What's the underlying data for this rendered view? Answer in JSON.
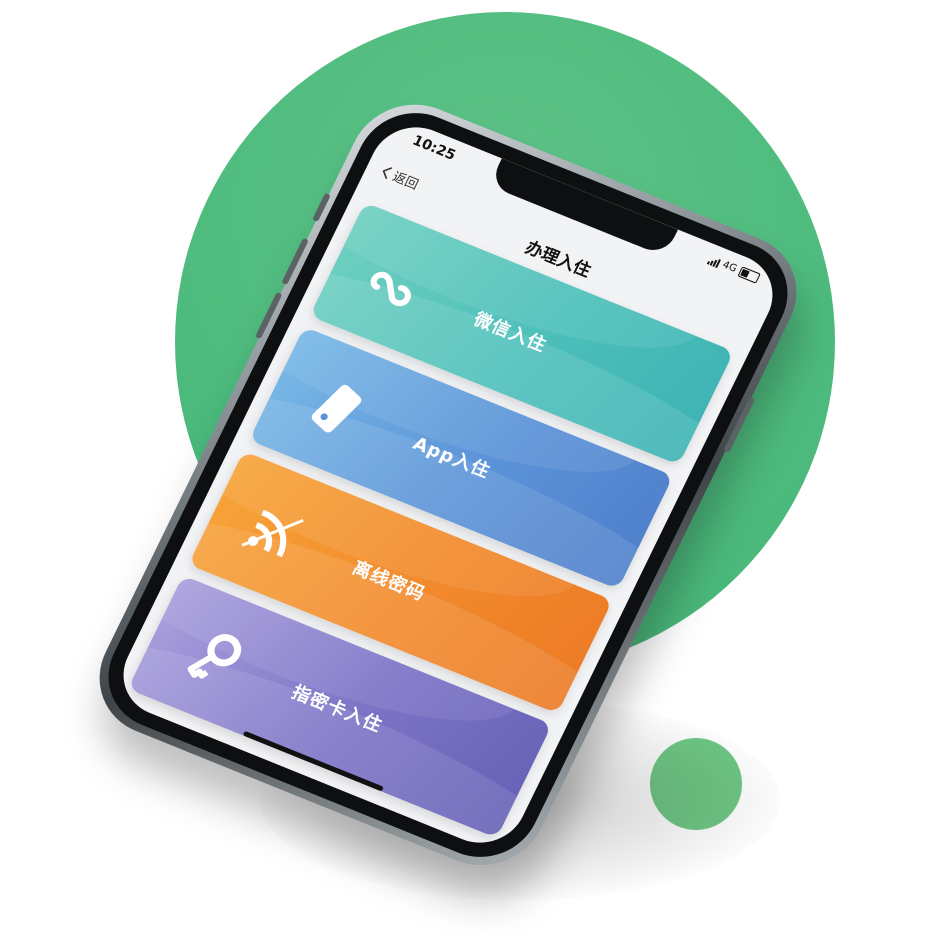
{
  "status_bar": {
    "time": "10:25",
    "network": "4G"
  },
  "nav": {
    "back_label": "返回",
    "title": "办理入住"
  },
  "cards": [
    {
      "label": "微信入住",
      "icon": "mini-program-icon",
      "color": "#4cbfba"
    },
    {
      "label": "App入住",
      "icon": "phone-key-icon",
      "color": "#5b93d8"
    },
    {
      "label": "离线密码",
      "icon": "offline-wifi-icon",
      "color": "#f28a2c"
    },
    {
      "label": "指密卡入住",
      "icon": "key-icon",
      "color": "#7c73c6"
    }
  ],
  "colors": {
    "background_circle": "#4dbb7d",
    "accent_dot": "#6dc783"
  }
}
